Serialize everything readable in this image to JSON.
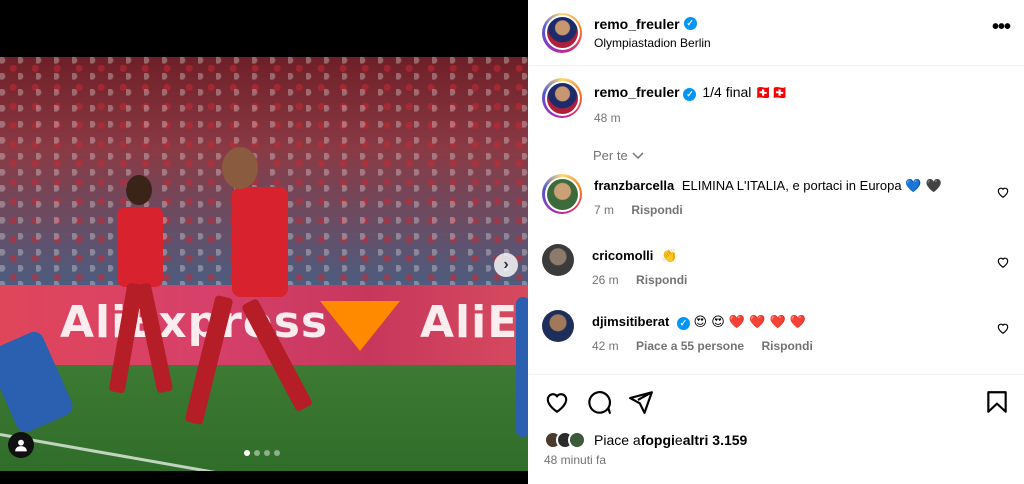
{
  "post": {
    "username": "remo_freuler",
    "location": "Olympiastadion Berlin",
    "caption": "1/4 final",
    "caption_flags": "🇨🇭🇨🇭",
    "caption_time": "48 m"
  },
  "media": {
    "board_text_left": "AliExpress",
    "board_text_right": "AliE",
    "carousel_dots": 4,
    "active_dot": 0
  },
  "comments_filter": "Per te",
  "comments": [
    {
      "user": "franzbarcella",
      "text": "ELIMINA L'ITALIA, e portaci in Europa",
      "emoji": "💙 🖤",
      "time": "7 m",
      "likes": "",
      "reply": "Rispondi",
      "verified": false
    },
    {
      "user": "cricomolli",
      "text": "",
      "emoji": "👏",
      "time": "26 m",
      "likes": "",
      "reply": "Rispondi",
      "verified": false
    },
    {
      "user": "djimsitiberat",
      "text": "",
      "emoji": "😍 😍 ❤️ ❤️ ❤️ ❤️",
      "time": "42 m",
      "likes": "Piace a 55 persone",
      "reply": "Rispondi",
      "verified": true
    }
  ],
  "likes": {
    "prefix": "Piace a ",
    "user": "fopgi",
    "middle": " e ",
    "others": "altri 3.159"
  },
  "time_ago": "48 minuti fa",
  "colors": {
    "verified": "#0095f6",
    "meta_gray": "#737373"
  }
}
